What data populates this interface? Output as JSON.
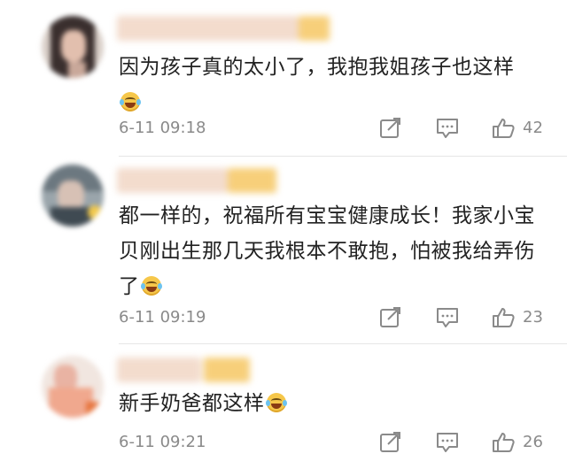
{
  "comments": [
    {
      "text": "因为孩子真的太小了，我抱我姐孩子也这样",
      "emoji_icon": "laugh-cry-emoji-icon",
      "time": "6-11 09:18",
      "likes": "42"
    },
    {
      "text": "都一样的，祝福所有宝宝健康成长！我家小宝贝刚出生那几天我根本不敢抱，怕被我给弄伤了",
      "emoji_icon": "laugh-cry-emoji-icon",
      "time": "6-11 09:19",
      "likes": "23"
    },
    {
      "text": "新手奶爸都这样",
      "emoji_icon": "laugh-cry-emoji-icon",
      "time": "6-11 09:21",
      "likes": "26"
    }
  ],
  "icons": {
    "share": "share-icon",
    "reply": "comment-icon",
    "like": "thumbs-up-icon"
  },
  "colors": {
    "text": "#222222",
    "meta": "#8a8a8a",
    "divider": "#e6e6e6",
    "emoji": "#f6c74a"
  }
}
